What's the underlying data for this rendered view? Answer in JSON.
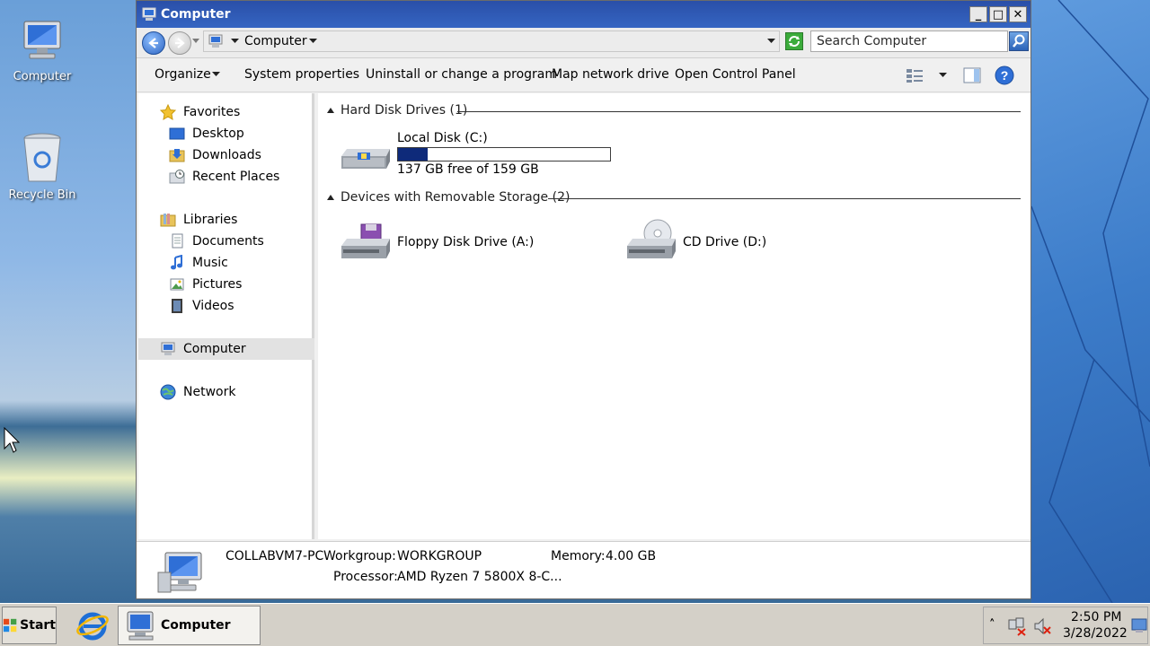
{
  "desktop": {
    "icons": [
      {
        "label": "Computer",
        "icon": "computer-icon"
      },
      {
        "label": "Recycle Bin",
        "icon": "recycle-bin-icon"
      }
    ]
  },
  "window": {
    "title": "Computer",
    "controls": {
      "minimize": "_",
      "maximize": "□",
      "close": "✕"
    }
  },
  "address": {
    "breadcrumb": "Computer",
    "search_placeholder": "Search Computer"
  },
  "toolbar": {
    "items": [
      "Organize",
      "System properties",
      "Uninstall or change a program",
      "Map network drive",
      "Open Control Panel"
    ]
  },
  "nav": {
    "favorites": "Favorites",
    "favorites_items": [
      "Desktop",
      "Downloads",
      "Recent Places"
    ],
    "libraries": "Libraries",
    "libraries_items": [
      "Documents",
      "Music",
      "Pictures",
      "Videos"
    ],
    "computer": "Computer",
    "network": "Network"
  },
  "content": {
    "hard_disk_header": "Hard Disk Drives (1)",
    "local_disk": {
      "name": "Local Disk (C:)",
      "free_text": "137 GB free of 159 GB",
      "used_fraction": 0.138
    },
    "removable_header": "Devices with Removable Storage (2)",
    "floppy": "Floppy Disk Drive (A:)",
    "cd": "CD Drive (D:)"
  },
  "details": {
    "pc_name": "COLLABVM7-PC",
    "workgroup_label": "Workgroup:",
    "workgroup_value": "WORKGROUP",
    "memory_label": "Memory:",
    "memory_value": "4.00 GB",
    "processor_label": "Processor:",
    "processor_value": "AMD Ryzen 7 5800X 8-C..."
  },
  "taskbar": {
    "start": "Start",
    "task_window": "Computer",
    "time": "2:50 PM",
    "date": "3/28/2022",
    "tray_expand": "˄"
  }
}
